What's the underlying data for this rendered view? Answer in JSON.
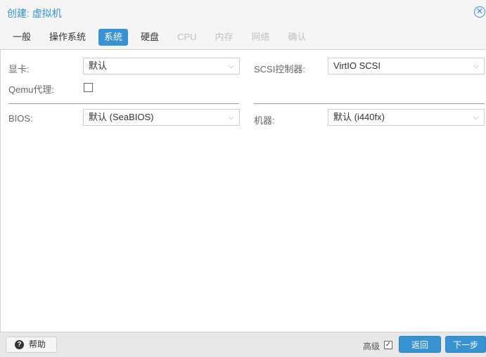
{
  "window": {
    "title": "创建: 虚拟机",
    "close_icon": "close-circle-icon"
  },
  "tabs": [
    {
      "label": "一般",
      "state": "normal"
    },
    {
      "label": "操作系统",
      "state": "normal"
    },
    {
      "label": "系统",
      "state": "active"
    },
    {
      "label": "硬盘",
      "state": "normal"
    },
    {
      "label": "CPU",
      "state": "disabled"
    },
    {
      "label": "内存",
      "state": "disabled"
    },
    {
      "label": "网络",
      "state": "disabled"
    },
    {
      "label": "确认",
      "state": "disabled"
    }
  ],
  "form": {
    "display": {
      "label": "显卡:",
      "value": "默认"
    },
    "scsi": {
      "label": "SCSI控制器:",
      "value": "VirtIO SCSI"
    },
    "qemu_agent": {
      "label": "Qemu代理:",
      "checked": false
    },
    "bios": {
      "label": "BIOS:",
      "value": "默认 (SeaBIOS)"
    },
    "machine": {
      "label": "机器:",
      "value": "默认 (i440fx)"
    },
    "chevron": "⌵"
  },
  "footer": {
    "help_label": "帮助",
    "help_icon": "?",
    "advanced_label": "高级",
    "advanced_checked": true,
    "advanced_check_glyph": "✓",
    "back_label": "返回",
    "next_label": "下一步"
  },
  "colors": {
    "accent": "#3892d4"
  }
}
